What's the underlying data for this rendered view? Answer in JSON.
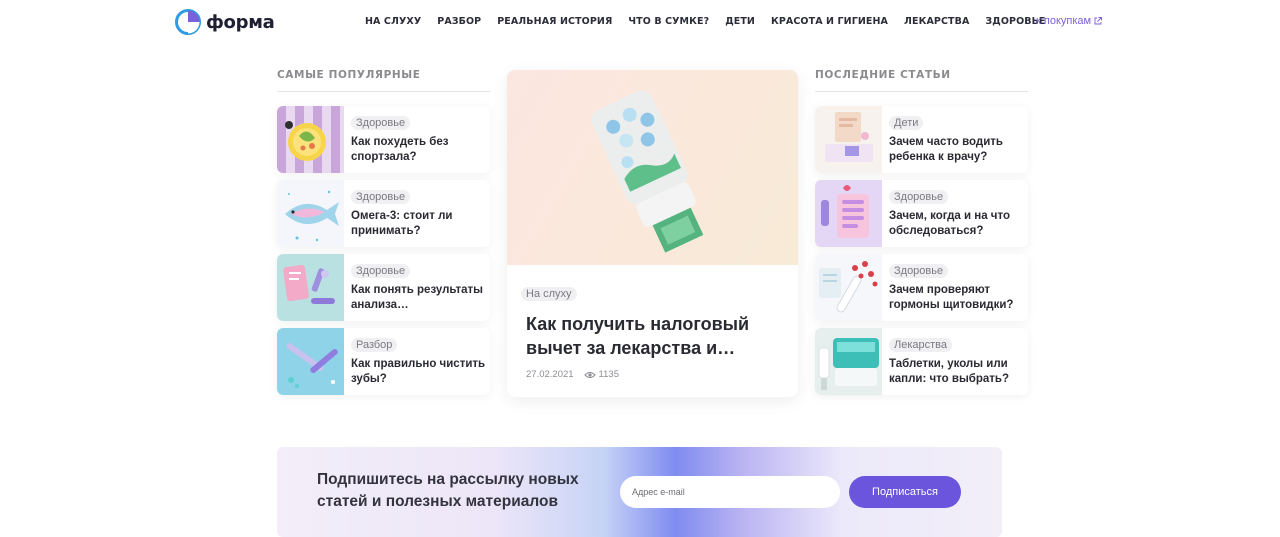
{
  "brand": {
    "name": "форма"
  },
  "nav": [
    "НА СЛУХУ",
    "РАЗБОР",
    "РЕАЛЬНАЯ ИСТОРИЯ",
    "ЧТО В СУМКЕ?",
    "ДЕТИ",
    "КРАСОТА И ГИГИЕНА",
    "ЛЕКАРСТВА",
    "ЗДОРОВЬЕ"
  ],
  "shop_link": "к покупкам",
  "popular": {
    "title": "САМЫЕ ПОПУЛЯРНЫЕ",
    "items": [
      {
        "tag": "Здоровье",
        "title": "Как похудеть без спортзала?",
        "icon": "salad-plate-icon"
      },
      {
        "tag": "Здоровье",
        "title": "Омега-3: стоит ли принимать?",
        "icon": "fish-icon"
      },
      {
        "tag": "Здоровье",
        "title": "Как понять результаты анализа…",
        "icon": "microscope-icon"
      },
      {
        "tag": "Разбор",
        "title": "Как правильно чистить зубы?",
        "icon": "toothbrush-icon"
      }
    ]
  },
  "featured": {
    "tag": "На слуху",
    "title": "Как получить налоговый вычет за лекарства и…",
    "date": "27.02.2021",
    "views": "1135",
    "image": "pill-bottle-with-money-icon"
  },
  "latest": {
    "title": "ПОСЛЕДНИЕ СТАТЬИ",
    "items": [
      {
        "tag": "Дети",
        "title": "Зачем часто водить ребенка к врачу?",
        "icon": "child-doctor-icon"
      },
      {
        "tag": "Здоровье",
        "title": "Зачем, когда и на что обследоваться?",
        "icon": "checklist-icon"
      },
      {
        "tag": "Здоровье",
        "title": "Зачем проверяют гормоны щитовидки?",
        "icon": "test-tubes-icon"
      },
      {
        "tag": "Лекарства",
        "title": "Таблетки, уколы или капли: что выбрать?",
        "icon": "first-aid-kit-icon"
      }
    ]
  },
  "newsletter": {
    "text": "Подпишитесь на рассылку новых статей и полезных материалов",
    "placeholder": "Адрес e-mail",
    "button": "Подписаться"
  },
  "colors": {
    "accent": "#6b55dc",
    "link": "#7b61d9",
    "logo_blue": "#2f9be6"
  }
}
